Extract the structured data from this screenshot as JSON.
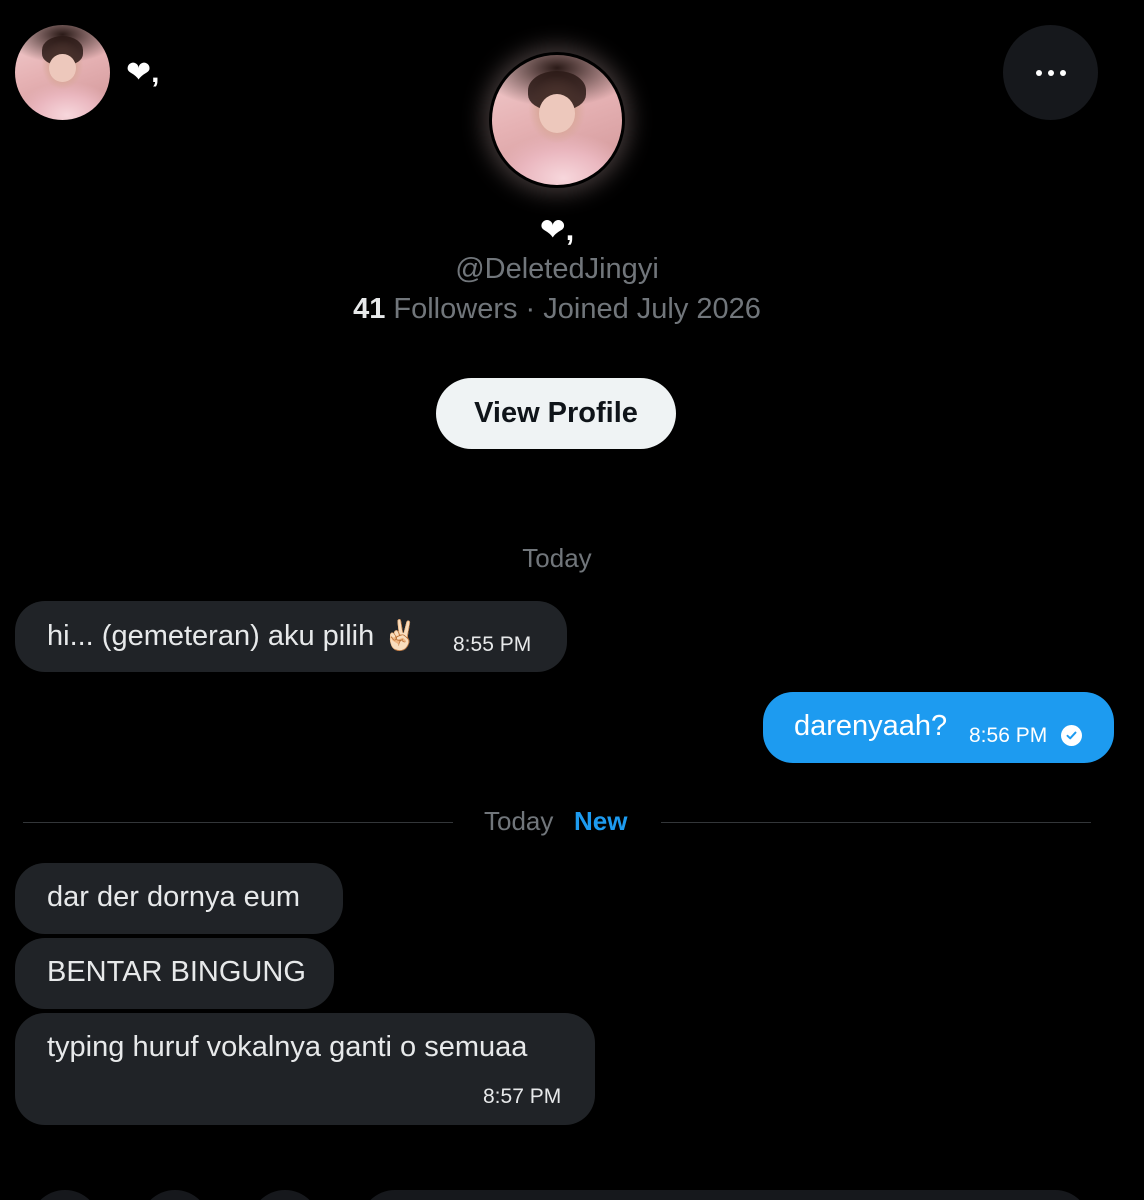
{
  "header": {
    "display_name": "❤,",
    "more_icon": "more-horizontal-icon"
  },
  "profile": {
    "display_name": "❤,",
    "handle": "@DeletedJingyi",
    "followers_count": "41",
    "followers_label": "Followers",
    "separator": "·",
    "joined": "Joined July 2026",
    "view_profile_label": "View Profile"
  },
  "conversation": {
    "date_label_1": "Today",
    "messages_before": [
      {
        "direction": "in",
        "text": "hi... (gemeteran) aku pilih ✌🏻",
        "time": "8:55 PM"
      },
      {
        "direction": "out",
        "text": "darenyaah?",
        "time": "8:56 PM",
        "status_icon": "sent-check-icon"
      }
    ],
    "new_divider": {
      "date_label": "Today",
      "new_label": "New"
    },
    "messages_after": [
      {
        "direction": "in",
        "text": "dar der dornya eum"
      },
      {
        "direction": "in",
        "text": "BENTAR BINGUNG"
      },
      {
        "direction": "in",
        "text": "typing huruf vokalnya ganti o semuaa",
        "time": "8:57 PM"
      }
    ]
  },
  "colors": {
    "background": "#000000",
    "incoming_bubble": "#202327",
    "outgoing_bubble": "#1d9bf0",
    "accent": "#1d9bf0",
    "muted_text": "#71767b"
  }
}
